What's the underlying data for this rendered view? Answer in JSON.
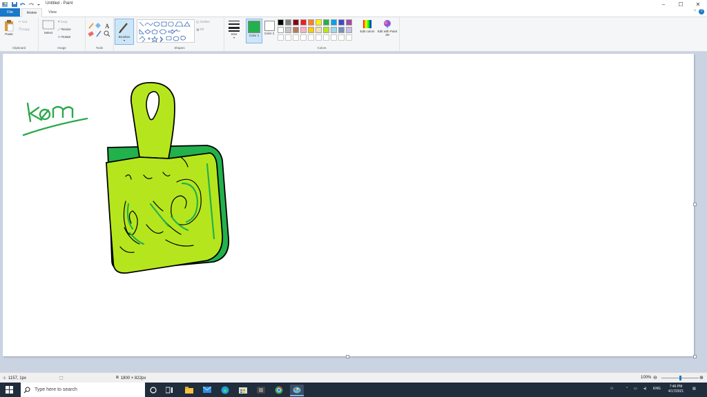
{
  "window": {
    "title": "Untitled - Paint",
    "controls": {
      "minimize": "–",
      "maximize": "☐",
      "close": "✕"
    }
  },
  "tabs": {
    "file": "File",
    "home": "Home",
    "view": "View"
  },
  "help": {
    "collapse": "^",
    "help": "?"
  },
  "ribbon": {
    "clipboard": {
      "label": "Clipboard",
      "paste": "Paste",
      "cut": "Cut",
      "copy": "Copy"
    },
    "image": {
      "label": "Image",
      "select": "Select",
      "crop": "Crop",
      "resize": "Resize",
      "rotate": "Rotate"
    },
    "tools": {
      "label": "Tools"
    },
    "brushes": {
      "label": "Brushes"
    },
    "shapes": {
      "label": "Shapes",
      "outline": "Outline",
      "fill": "Fill"
    },
    "size": {
      "label": "Size"
    },
    "colors": {
      "label": "Colors",
      "color1": "Color 1",
      "color2": "Color 2",
      "edit": "Edit colors",
      "paint3d": "Edit with Paint 3D",
      "color1_value": "#22b14c",
      "color2_value": "#ffffff",
      "palette_row1": [
        "#000000",
        "#7f7f7f",
        "#880015",
        "#ed1c24",
        "#ff7f27",
        "#fff200",
        "#22b14c",
        "#00a2e8",
        "#3f48cc",
        "#a349a4"
      ],
      "palette_row2": [
        "#ffffff",
        "#c3c3c3",
        "#b97a57",
        "#ffaec9",
        "#ffc90e",
        "#efe4b0",
        "#b5e61d",
        "#99d9ea",
        "#7092be",
        "#c8bfe7"
      ]
    }
  },
  "canvas": {
    "drawing_text": "kam"
  },
  "status": {
    "cursor_pos": "1157, 1px",
    "selection": "",
    "image_size": "1800 × 822px",
    "zoom": "100%",
    "zoom_level": 0.5
  },
  "taskbar": {
    "search_placeholder": "Type here to search",
    "lang": "ENG",
    "time": "7:46 PM",
    "date": "4/17/2021"
  }
}
